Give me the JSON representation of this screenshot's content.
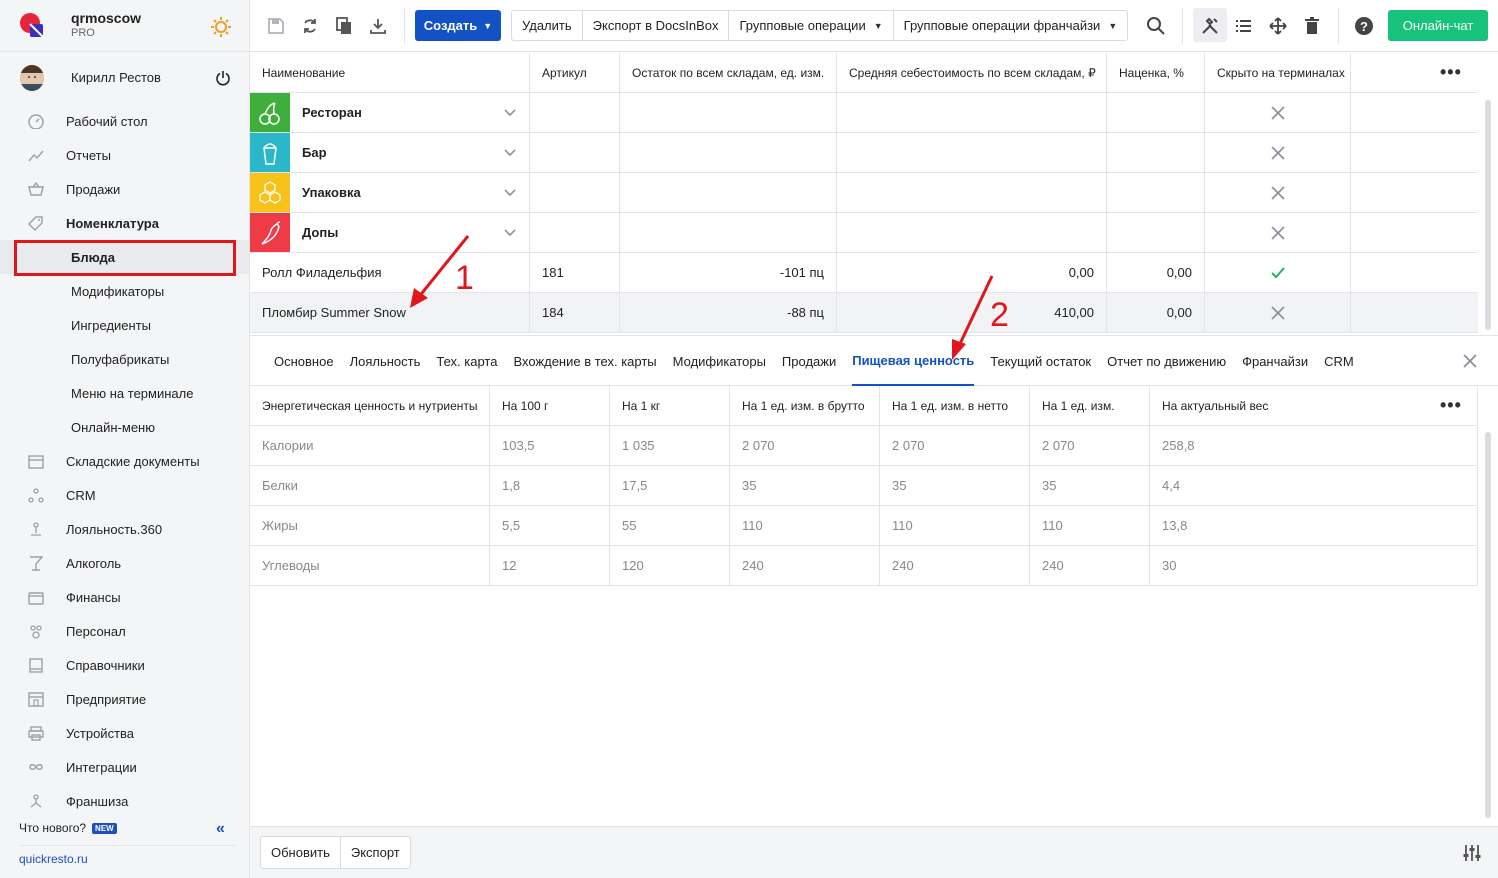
{
  "brand": {
    "name": "qrmoscow",
    "plan": "PRO"
  },
  "user": {
    "name": "Кирилл Рестов"
  },
  "nav": [
    {
      "label": "Рабочий стол",
      "icon": "dashboard-icon",
      "bold": false
    },
    {
      "label": "Отчеты",
      "icon": "reports-icon",
      "bold": false
    },
    {
      "label": "Продажи",
      "icon": "sales-basket-icon",
      "bold": false
    },
    {
      "label": "Номенклатура",
      "icon": "tag-icon",
      "bold": true
    },
    {
      "label": "Блюда",
      "sub": true,
      "active": true
    },
    {
      "label": "Модификаторы",
      "sub": true
    },
    {
      "label": "Ингредиенты",
      "sub": true
    },
    {
      "label": "Полуфабрикаты",
      "sub": true
    },
    {
      "label": "Меню на терминале",
      "sub": true
    },
    {
      "label": "Онлайн-меню",
      "sub": true
    },
    {
      "label": "Складские документы",
      "icon": "warehouse-icon"
    },
    {
      "label": "CRM",
      "icon": "crm-icon"
    },
    {
      "label": "Лояльность.360",
      "icon": "loyalty-icon"
    },
    {
      "label": "Алкоголь",
      "icon": "glass-icon"
    },
    {
      "label": "Финансы",
      "icon": "wallet-icon"
    },
    {
      "label": "Персонал",
      "icon": "staff-icon"
    },
    {
      "label": "Справочники",
      "icon": "book-icon"
    },
    {
      "label": "Предприятие",
      "icon": "store-icon"
    },
    {
      "label": "Устройства",
      "icon": "printer-icon"
    },
    {
      "label": "Интеграции",
      "icon": "infinity-icon"
    },
    {
      "label": "Франшиза",
      "icon": "franchise-icon"
    }
  ],
  "sidebar_footer": {
    "whats_new": "Что нового?",
    "new_badge": "NEW",
    "site": "quickresto.ru"
  },
  "toolbar": {
    "create": "Создать",
    "delete": "Удалить",
    "export_docs": "Экспорт в DocsInBox",
    "group_ops": "Групповые операции",
    "group_ops_fr": "Групповые операции франчайзи",
    "chat": "Онлайн-чат"
  },
  "grid1": {
    "headers": [
      "Наименование",
      "Артикул",
      "Остаток по всем складам, ед. изм.",
      "Средняя себестоимость по всем складам, ₽",
      "Наценка, %",
      "Скрыто на терминалах"
    ],
    "categories": [
      {
        "name": "Ресторан",
        "color": "#3daf3a",
        "icon": "cherry-icon"
      },
      {
        "name": "Бар",
        "color": "#29b7c9",
        "icon": "cup-icon"
      },
      {
        "name": "Упаковка",
        "color": "#f7c21a",
        "icon": "honeycomb-icon"
      },
      {
        "name": "Допы",
        "color": "#ee3b46",
        "icon": "pepper-icon"
      }
    ],
    "items": [
      {
        "name": "Ролл Филадельфия",
        "article": "181",
        "stock": "-101 пц",
        "cost": "0,00",
        "markup": "0,00",
        "hidden": false
      },
      {
        "name": "Пломбир Summer Snow",
        "article": "184",
        "stock": "-88 пц",
        "cost": "410,00",
        "markup": "0,00",
        "hidden": true
      }
    ]
  },
  "tabs": [
    "Основное",
    "Лояльность",
    "Тех. карта",
    "Вхождение в тех. карты",
    "Модификаторы",
    "Продажи",
    "Пищевая ценность",
    "Текущий остаток",
    "Отчет по движению",
    "Франчайзи",
    "CRM"
  ],
  "active_tab": 6,
  "grid2": {
    "headers": [
      "Энергетическая ценность и нутриенты",
      "На 100 г",
      "На 1 кг",
      "На 1 ед. изм. в брутто",
      "На 1 ед. изм. в нетто",
      "На 1 ед. изм.",
      "На актуальный вес"
    ],
    "rows": [
      [
        "Калории",
        "103,5",
        "1 035",
        "2 070",
        "2 070",
        "2 070",
        "258,8"
      ],
      [
        "Белки",
        "1,8",
        "17,5",
        "35",
        "35",
        "35",
        "4,4"
      ],
      [
        "Жиры",
        "5,5",
        "55",
        "110",
        "110",
        "110",
        "13,8"
      ],
      [
        "Углеводы",
        "12",
        "120",
        "240",
        "240",
        "240",
        "30"
      ]
    ]
  },
  "footer": {
    "refresh": "Обновить",
    "export": "Экспорт"
  },
  "annotations": [
    "1",
    "2"
  ]
}
